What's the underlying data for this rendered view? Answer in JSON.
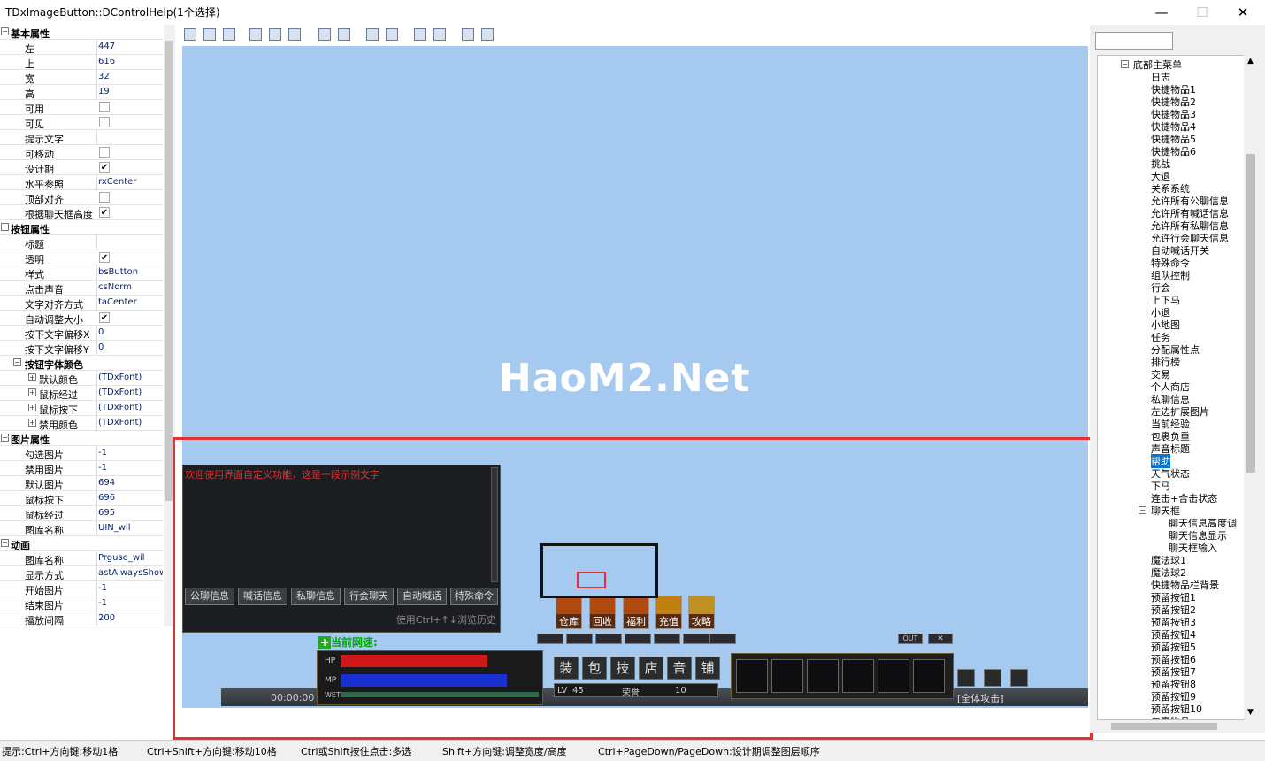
{
  "window": {
    "title": "TDxImageButton::DControlHelp(1个选择)",
    "minimize": "—",
    "maximize": "☐",
    "close": "✕"
  },
  "properties": {
    "sec_basic": "基本属性",
    "left": "左",
    "left_v": "447",
    "top": "上",
    "top_v": "616",
    "width": "宽",
    "width_v": "32",
    "height": "高",
    "height_v": "19",
    "enabled": "可用",
    "visible": "可见",
    "hint": "提示文字",
    "movable": "可移动",
    "design": "设计期",
    "halign": "水平参照",
    "halign_v": "rxCenter",
    "topalign": "顶部对齐",
    "chatheight": "根据聊天框高度",
    "sec_button": "按钮属性",
    "caption": "标题",
    "transparent": "透明",
    "style": "样式",
    "style_v": "bsButton",
    "sound": "点击声音",
    "sound_v": "csNorm",
    "textalign": "文字对齐方式",
    "textalign_v": "taCenter",
    "autosize": "自动调整大小",
    "offx": "按下文字偏移X",
    "offx_v": "0",
    "offy": "按下文字偏移Y",
    "offy_v": "0",
    "sec_font": "按钮字体颜色",
    "f_default": "默认颜色",
    "f_hover": "鼠标经过",
    "f_down": "鼠标按下",
    "f_disabled": "禁用颜色",
    "font_v": "(TDxFont)",
    "sec_image": "图片属性",
    "img_check": "勾选图片",
    "img_check_v": "-1",
    "img_disabled": "禁用图片",
    "img_disabled_v": "-1",
    "img_default": "默认图片",
    "img_default_v": "694",
    "img_down": "鼠标按下",
    "img_down_v": "696",
    "img_hover": "鼠标经过",
    "img_hover_v": "695",
    "lib": "图库名称",
    "lib_v": "UIN_wil",
    "sec_anim": "动画",
    "anim_lib": "图库名称",
    "anim_lib_v": "Prguse_wil",
    "show_mode": "显示方式",
    "show_mode_v": "astAlwaysShow",
    "start_img": "开始图片",
    "start_img_v": "-1",
    "end_img": "结束图片",
    "end_img_v": "-1",
    "interval": "播放间隔",
    "interval_v": "200",
    "check": "✔"
  },
  "canvas": {
    "watermark": "HaoM2.Net",
    "chat_msg": "欢迎使用界面自定义功能，这是一段示例文字",
    "chat_tabs": [
      "公聊信息",
      "喊话信息",
      "私聊信息",
      "行会聊天",
      "自动喊话",
      "特殊命令"
    ],
    "chat_hint": "使用Ctrl+↑↓浏览历史",
    "game_btns": [
      "仓库",
      "回收",
      "福利",
      "充值",
      "攻略"
    ],
    "cur_map": "当前网速:",
    "time": "00:00:00",
    "hp": "HP",
    "mp": "MP",
    "wet": "WET",
    "skills": [
      "装",
      "包",
      "技",
      "店",
      "音",
      "铺"
    ],
    "lv_label": "LV",
    "lv": "45",
    "honor": "荣誉",
    "honor_v": "10",
    "attack_mode": "[全体攻击]",
    "out": "OUT",
    "x": "✕"
  },
  "tree": {
    "root": "底部主菜单",
    "items": [
      "日志",
      "快捷物品1",
      "快捷物品2",
      "快捷物品3",
      "快捷物品4",
      "快捷物品5",
      "快捷物品6",
      "挑战",
      "大退",
      "关系系统",
      "允许所有公聊信息",
      "允许所有喊话信息",
      "允许所有私聊信息",
      "允许行会聊天信息",
      "自动喊话开关",
      "特殊命令",
      "组队控制",
      "行会",
      "上下马",
      "小退",
      "小地图",
      "任务",
      "分配属性点",
      "排行榜",
      "交易",
      "个人商店",
      "私聊信息",
      "左边扩展图片",
      "当前经验",
      "包裹负重",
      "声音标题",
      "帮助",
      "天气状态",
      "下马",
      "连击+合击状态"
    ],
    "chat_node": "聊天框",
    "chat_children": [
      "聊天信息高度调",
      "聊天信息显示",
      "聊天框输入"
    ],
    "items2": [
      "魔法球1",
      "魔法球2",
      "快捷物品栏背景",
      "预留按钮1",
      "预留按钮2",
      "预留按钮3",
      "预留按钮4",
      "预留按钮5",
      "预留按钮6",
      "预留按钮7",
      "预留按钮8",
      "预留按钮9",
      "预留按钮10",
      "包裹物品"
    ],
    "selected": "帮助"
  },
  "status": {
    "s1": "提示:Ctrl+方向键:移动1格",
    "s2": "Ctrl+Shift+方向键:移动10格",
    "s3": "Ctrl或Shift按住点击:多选",
    "s4": "Shift+方向键:调整宽度/高度",
    "s5": "Ctrl+PageDown/PageDown:设计期调整图层顺序"
  },
  "colors": {
    "canvas": "#a6c9f0",
    "highlight": "#e53030",
    "select": "#0078d7"
  }
}
